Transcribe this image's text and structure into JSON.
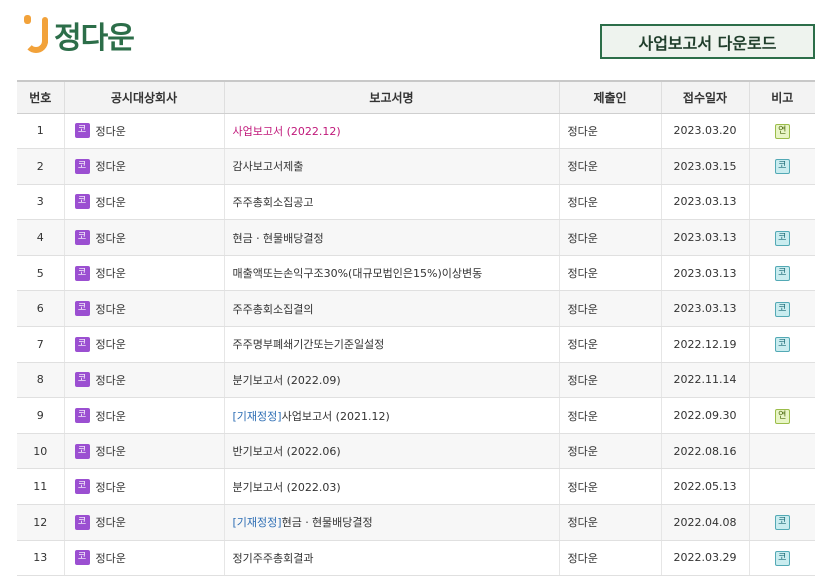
{
  "logo": {
    "text": "정다운"
  },
  "download_button": {
    "label": "사업보고서 다운로드"
  },
  "table": {
    "headers": [
      "번호",
      "공시대상회사",
      "보고서명",
      "제출인",
      "접수일자",
      "비고"
    ],
    "corp_badge": "코",
    "rows": [
      {
        "no": "1",
        "company": "정다운",
        "prefix": "",
        "title": "사업보고서 (2022.12)",
        "highlight": true,
        "submitter": "정다운",
        "date": "2023.03.20",
        "note": "연",
        "note_type": "yeon"
      },
      {
        "no": "2",
        "company": "정다운",
        "prefix": "",
        "title": "감사보고서제출",
        "highlight": false,
        "submitter": "정다운",
        "date": "2023.03.15",
        "note": "코",
        "note_type": "ko"
      },
      {
        "no": "3",
        "company": "정다운",
        "prefix": "",
        "title": "주주총회소집공고",
        "highlight": false,
        "submitter": "정다운",
        "date": "2023.03.13",
        "note": "",
        "note_type": ""
      },
      {
        "no": "4",
        "company": "정다운",
        "prefix": "",
        "title": "현금ㆍ현물배당결정",
        "highlight": false,
        "submitter": "정다운",
        "date": "2023.03.13",
        "note": "코",
        "note_type": "ko"
      },
      {
        "no": "5",
        "company": "정다운",
        "prefix": "",
        "title": "매출액또는손익구조30%(대규모법인은15%)이상변동",
        "highlight": false,
        "submitter": "정다운",
        "date": "2023.03.13",
        "note": "코",
        "note_type": "ko"
      },
      {
        "no": "6",
        "company": "정다운",
        "prefix": "",
        "title": "주주총회소집결의",
        "highlight": false,
        "submitter": "정다운",
        "date": "2023.03.13",
        "note": "코",
        "note_type": "ko"
      },
      {
        "no": "7",
        "company": "정다운",
        "prefix": "",
        "title": "주주명부폐쇄기간또는기준일설정",
        "highlight": false,
        "submitter": "정다운",
        "date": "2022.12.19",
        "note": "코",
        "note_type": "ko"
      },
      {
        "no": "8",
        "company": "정다운",
        "prefix": "",
        "title": "분기보고서 (2022.09)",
        "highlight": false,
        "submitter": "정다운",
        "date": "2022.11.14",
        "note": "",
        "note_type": ""
      },
      {
        "no": "9",
        "company": "정다운",
        "prefix": "[기재정정]",
        "title": "사업보고서 (2021.12)",
        "highlight": false,
        "submitter": "정다운",
        "date": "2022.09.30",
        "note": "연",
        "note_type": "yeon"
      },
      {
        "no": "10",
        "company": "정다운",
        "prefix": "",
        "title": "반기보고서 (2022.06)",
        "highlight": false,
        "submitter": "정다운",
        "date": "2022.08.16",
        "note": "",
        "note_type": ""
      },
      {
        "no": "11",
        "company": "정다운",
        "prefix": "",
        "title": "분기보고서 (2022.03)",
        "highlight": false,
        "submitter": "정다운",
        "date": "2022.05.13",
        "note": "",
        "note_type": ""
      },
      {
        "no": "12",
        "company": "정다운",
        "prefix": "[기재정정]",
        "title": "현금ㆍ현물배당결정",
        "highlight": false,
        "submitter": "정다운",
        "date": "2022.04.08",
        "note": "코",
        "note_type": "ko"
      },
      {
        "no": "13",
        "company": "정다운",
        "prefix": "",
        "title": "정기주주총회결과",
        "highlight": false,
        "submitter": "정다운",
        "date": "2022.03.29",
        "note": "코",
        "note_type": "ko"
      }
    ]
  }
}
